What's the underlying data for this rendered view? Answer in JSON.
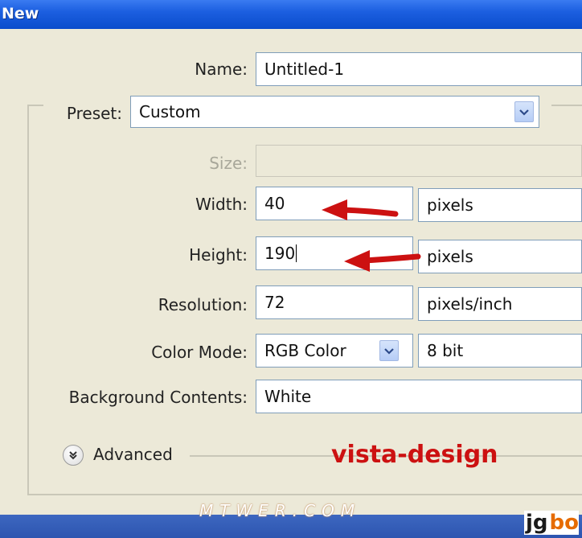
{
  "window": {
    "title": "New"
  },
  "form": {
    "name_label": "Name:",
    "name_value": "Untitled-1",
    "preset_label": "Preset:",
    "preset_value": "Custom",
    "size_label": "Size:",
    "size_value": "",
    "width_label": "Width:",
    "width_value": "40",
    "width_unit": "pixels",
    "height_label": "Height:",
    "height_value": "190",
    "height_unit": "pixels",
    "resolution_label": "Resolution:",
    "resolution_value": "72",
    "resolution_unit": "pixels/inch",
    "color_mode_label": "Color Mode:",
    "color_mode_value": "RGB Color",
    "bit_depth_value": "8 bit",
    "background_label": "Background Contents:",
    "background_value": "White",
    "advanced_label": "Advanced"
  },
  "watermarks": {
    "vista": "vista-design",
    "mtwer": "MTWER.COM",
    "logo_part1": "jg",
    "logo_part2": "bo"
  },
  "icons": {
    "advanced_toggle": "chevron-double-down-icon",
    "combo_arrow": "chevron-down-icon",
    "annotation_arrow": "red-arrow-icon"
  },
  "colors": {
    "titlebar": "#0a4ccc",
    "dialog_bg": "#ece9d8",
    "annotation_red": "#cc1111",
    "field_border": "#7f9db9"
  }
}
